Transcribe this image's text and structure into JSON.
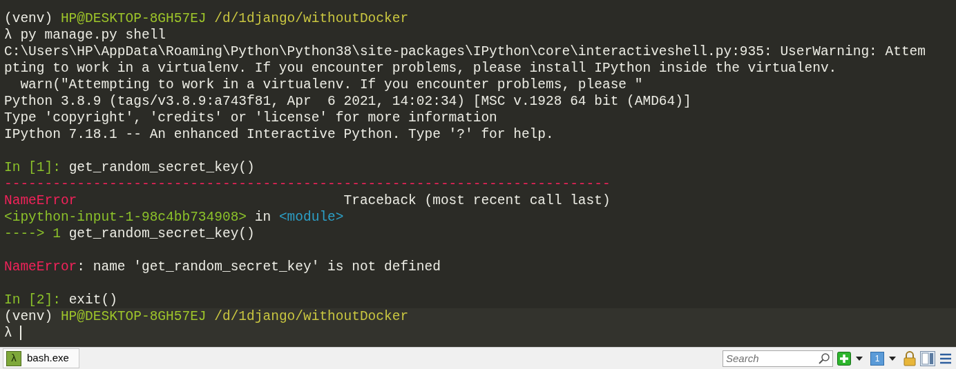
{
  "terminal": {
    "lines": [
      {
        "kind": "text",
        "segments": [
          {
            "kind": "default",
            "text": "(venv) "
          },
          {
            "kind": "host",
            "text": "HP@DESKTOP-8GH57EJ"
          },
          {
            "kind": "path",
            "text": " /d/1django/withoutDocker"
          }
        ]
      },
      {
        "kind": "text",
        "segments": [
          {
            "kind": "default",
            "text": "λ py manage.py shell"
          }
        ]
      },
      {
        "kind": "text",
        "segments": [
          {
            "kind": "default",
            "text": "C:\\Users\\HP\\AppData\\Roaming\\Python\\Python38\\site-packages\\IPython\\core\\interactiveshell.py:935: UserWarning: Attem"
          }
        ]
      },
      {
        "kind": "text",
        "segments": [
          {
            "kind": "default",
            "text": "pting to work in a virtualenv. If you encounter problems, please install IPython inside the virtualenv."
          }
        ]
      },
      {
        "kind": "text",
        "segments": [
          {
            "kind": "default",
            "text": "  warn(\"Attempting to work in a virtualenv. If you encounter problems, please \""
          }
        ]
      },
      {
        "kind": "text",
        "segments": [
          {
            "kind": "default",
            "text": "Python 3.8.9 (tags/v3.8.9:a743f81, Apr  6 2021, 14:02:34) [MSC v.1928 64 bit (AMD64)]"
          }
        ]
      },
      {
        "kind": "text",
        "segments": [
          {
            "kind": "default",
            "text": "Type 'copyright', 'credits' or 'license' for more information"
          }
        ]
      },
      {
        "kind": "text",
        "segments": [
          {
            "kind": "default",
            "text": "IPython 7.18.1 -- An enhanced Interactive Python. Type '?' for help."
          }
        ]
      },
      {
        "kind": "blank"
      },
      {
        "kind": "text",
        "segments": [
          {
            "kind": "prompt",
            "text": "In [1]: "
          },
          {
            "kind": "default",
            "text": "get_random_secret_key()"
          }
        ]
      },
      {
        "kind": "text",
        "segments": [
          {
            "kind": "error",
            "text": "---------------------------------------------------------------------------"
          }
        ]
      },
      {
        "kind": "text",
        "segments": [
          {
            "kind": "error",
            "text": "NameError"
          },
          {
            "kind": "default",
            "text": "                                 Traceback (most recent call last)"
          }
        ]
      },
      {
        "kind": "text",
        "segments": [
          {
            "kind": "prompt",
            "text": "<ipython-input-1-98c4bb734908>"
          },
          {
            "kind": "default",
            "text": " in "
          },
          {
            "kind": "module",
            "text": "<module>"
          }
        ]
      },
      {
        "kind": "text",
        "segments": [
          {
            "kind": "prompt",
            "text": "----> 1 "
          },
          {
            "kind": "default",
            "text": "get_random_secret_key()"
          }
        ]
      },
      {
        "kind": "blank"
      },
      {
        "kind": "text",
        "segments": [
          {
            "kind": "error",
            "text": "NameError"
          },
          {
            "kind": "default",
            "text": ": name 'get_random_secret_key' is not defined"
          }
        ]
      },
      {
        "kind": "blank"
      },
      {
        "kind": "text",
        "segments": [
          {
            "kind": "prompt",
            "text": "In [2]: "
          },
          {
            "kind": "default",
            "text": "exit()"
          }
        ]
      }
    ],
    "current_prompt": [
      {
        "kind": "text",
        "segments": [
          {
            "kind": "default",
            "text": "(venv) "
          },
          {
            "kind": "host",
            "text": "HP@DESKTOP-8GH57EJ"
          },
          {
            "kind": "path",
            "text": " /d/1django/withoutDocker"
          }
        ]
      },
      {
        "kind": "input",
        "segments": [
          {
            "kind": "default",
            "text": "λ "
          }
        ]
      }
    ]
  },
  "status_bar": {
    "tab": {
      "icon_glyph": "λ",
      "label": "bash.exe",
      "selected": true
    },
    "search": {
      "placeholder": "Search"
    },
    "console_number": "1"
  }
}
